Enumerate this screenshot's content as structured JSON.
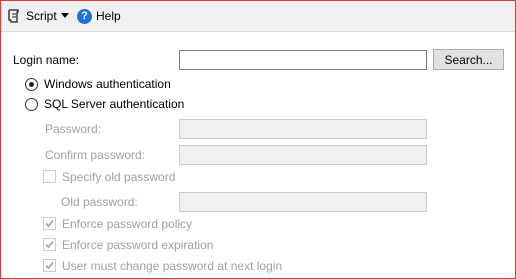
{
  "toolbar": {
    "script_label": "Script",
    "help_label": "Help",
    "help_icon_glyph": "?",
    "script_icon": "script-icon",
    "help_icon": "help-circle-icon"
  },
  "form": {
    "login_name_label": "Login name:",
    "login_name_value": "",
    "search_button": "Search...",
    "auth": {
      "windows_label": "Windows authentication",
      "windows_checked": true,
      "sql_label": "SQL Server authentication",
      "sql_checked": false
    },
    "sql_options": {
      "password_label": "Password:",
      "password_value": "",
      "confirm_password_label": "Confirm password:",
      "confirm_password_value": "",
      "specify_old_password_label": "Specify old password",
      "specify_old_password_checked": false,
      "old_password_label": "Old password:",
      "old_password_value": "",
      "enforce_policy_label": "Enforce password policy",
      "enforce_policy_checked": true,
      "enforce_expiration_label": "Enforce password expiration",
      "enforce_expiration_checked": true,
      "must_change_label": "User must change password at next login",
      "must_change_checked": true
    }
  },
  "colors": {
    "frame_border": "#d43b3b",
    "help_icon": "#1e73d8",
    "disabled_text": "#a0a0a0"
  }
}
